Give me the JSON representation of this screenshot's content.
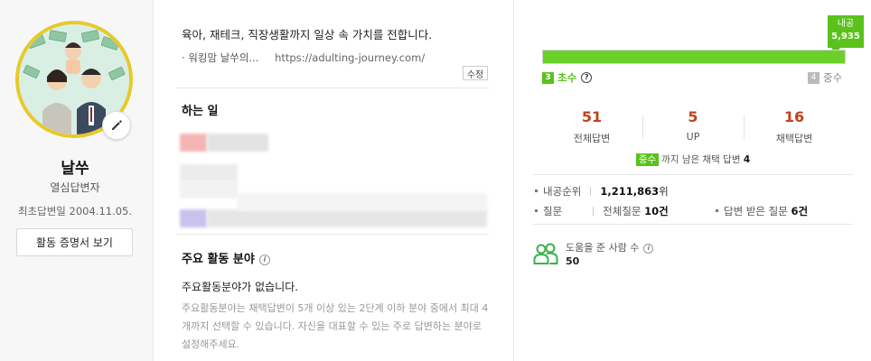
{
  "profile": {
    "nickname": "날쑤",
    "rank": "열심답변자",
    "first_answer": "최초답변일 2004.11.05.",
    "certificate_button": "활동 증명서 보기"
  },
  "intro": {
    "text": "육아, 재테크, 직장생활까지 일상 속 가치를 전합니다.",
    "link_label": "· 워킹맘 날쑤의...",
    "link_url": "https://adulting-journey.com/",
    "edit_label": "수정"
  },
  "work": {
    "title": "하는 일"
  },
  "field": {
    "title": "주요 활동 분야",
    "info_icon": "i",
    "empty_text": "주요활동분야가 없습니다.",
    "help_text": "주요활동분야는 채택답변이 5개 이상 있는 2단계 이하 분야 중에서 최대 4개까지 선택할 수 있습니다. 자신을 대표할 수 있는 주로 답변하는 분야로 설정해주세요."
  },
  "level": {
    "points_label": "내공",
    "points_value": "5,935",
    "progress": 1.0,
    "current_num": "3",
    "current_name": "초수",
    "help_icon": "?",
    "next_num": "4",
    "next_name": "중수"
  },
  "stats": [
    {
      "value": "51",
      "label": "전체답변"
    },
    {
      "value": "5",
      "label": "UP"
    },
    {
      "value": "16",
      "label": "채택답변"
    }
  ],
  "next_level": {
    "tag": "중수",
    "text": "까지 남은 채택 답변",
    "count": "4"
  },
  "details": {
    "rank_label": "내공순위",
    "rank_value": "1,211,863",
    "rank_unit": "위",
    "question_label": "질문",
    "total_q_label": "전체질문",
    "total_q_value": "10건",
    "answered_q_label": "답변 받은 질문",
    "answered_q_value": "6건"
  },
  "helped": {
    "label": "도움을 준 사람 수",
    "info_icon": "i",
    "value": "50"
  },
  "colors": {
    "accent_green": "#5ac21b",
    "stat_red": "#c0421d",
    "avatar_border": "#e7c929"
  }
}
